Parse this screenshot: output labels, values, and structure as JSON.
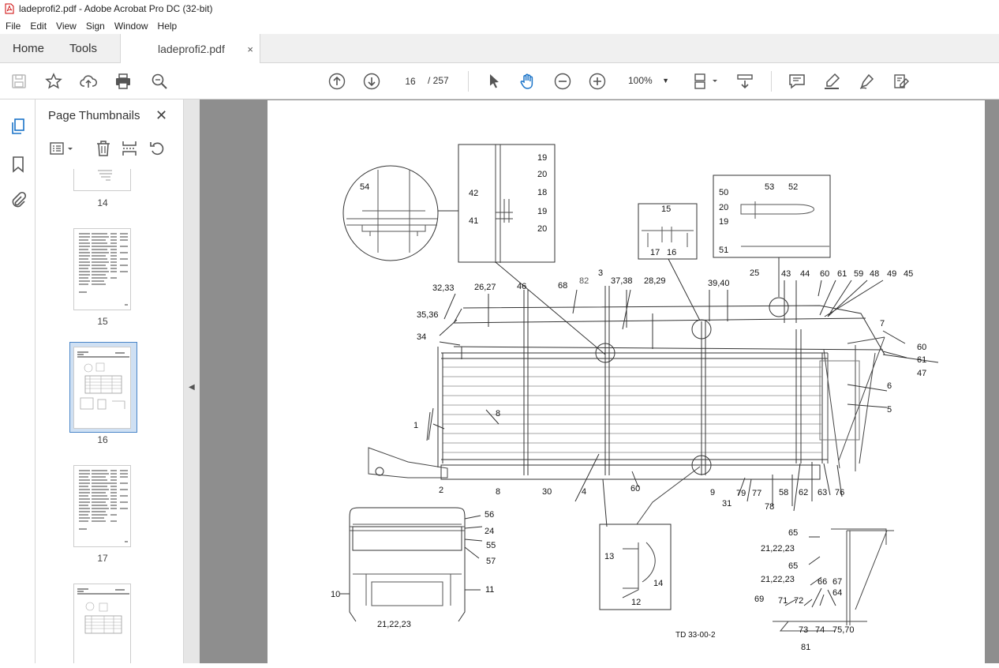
{
  "window": {
    "title": "ladeprofi2.pdf - Adobe Acrobat Pro DC (32-bit)"
  },
  "menu": [
    "File",
    "Edit",
    "View",
    "Sign",
    "Window",
    "Help"
  ],
  "tabs": {
    "home": "Home",
    "tools": "Tools",
    "document": "ladeprofi2.pdf",
    "close": "×"
  },
  "toolbar": {
    "page_current": "16",
    "page_total": "/ 257",
    "zoom": "100%"
  },
  "panel": {
    "title": "Page Thumbnails",
    "close": "✕"
  },
  "thumbnails": [
    {
      "label": "14"
    },
    {
      "label": "15"
    },
    {
      "label": "16"
    },
    {
      "label": "17"
    }
  ],
  "drawing": {
    "footer": "TD 33-00-2",
    "labels": {
      "l54": "54",
      "l19a": "19",
      "l20a": "20",
      "l42": "42",
      "l18": "18",
      "l19b": "19",
      "l41": "41",
      "l20b": "20",
      "l15a": "15",
      "l17": "17",
      "l16": "16",
      "l50": "50",
      "l53": "53",
      "l52": "52",
      "l20c": "20",
      "l19c": "19",
      "l51": "51",
      "l3233": "32,33",
      "l2627": "26,27",
      "l46": "46",
      "l68": "68",
      "l82": "82",
      "l3": "3",
      "l3738": "37,38",
      "l2829": "28,29",
      "l3940": "39,40",
      "l25": "25",
      "l43": "43",
      "l44": "44",
      "l60a": "60",
      "l61a": "61",
      "l59": "59",
      "l48": "48",
      "l49": "49",
      "l45": "45",
      "l3536": "35,36",
      "l34": "34",
      "l7": "7",
      "l60b": "60",
      "l61b": "61",
      "l47": "47",
      "l6": "6",
      "l5": "5",
      "l1": "1",
      "l8": "8",
      "l9": "9",
      "l2": "2",
      "l30": "30",
      "l4": "4",
      "l60c": "60",
      "l31": "31",
      "l79": "79",
      "l77": "77",
      "l78": "78",
      "l58": "58",
      "l62": "62",
      "l63": "63",
      "l76": "76",
      "l56": "56",
      "l24": "24",
      "l55": "55",
      "l57": "57",
      "l10": "10",
      "l11": "11",
      "l212223a": "21,22,23",
      "l13": "13",
      "l14": "14",
      "l12": "12",
      "l65a": "65",
      "l212223b": "21,22,23",
      "l65b": "65",
      "l212223c": "21,22,23",
      "l66": "66",
      "l67": "67",
      "l64": "64",
      "l69": "69",
      "l71": "71",
      "l72": "72",
      "l73": "73",
      "l74": "74",
      "l7570": "75,70",
      "l81": "81"
    }
  }
}
